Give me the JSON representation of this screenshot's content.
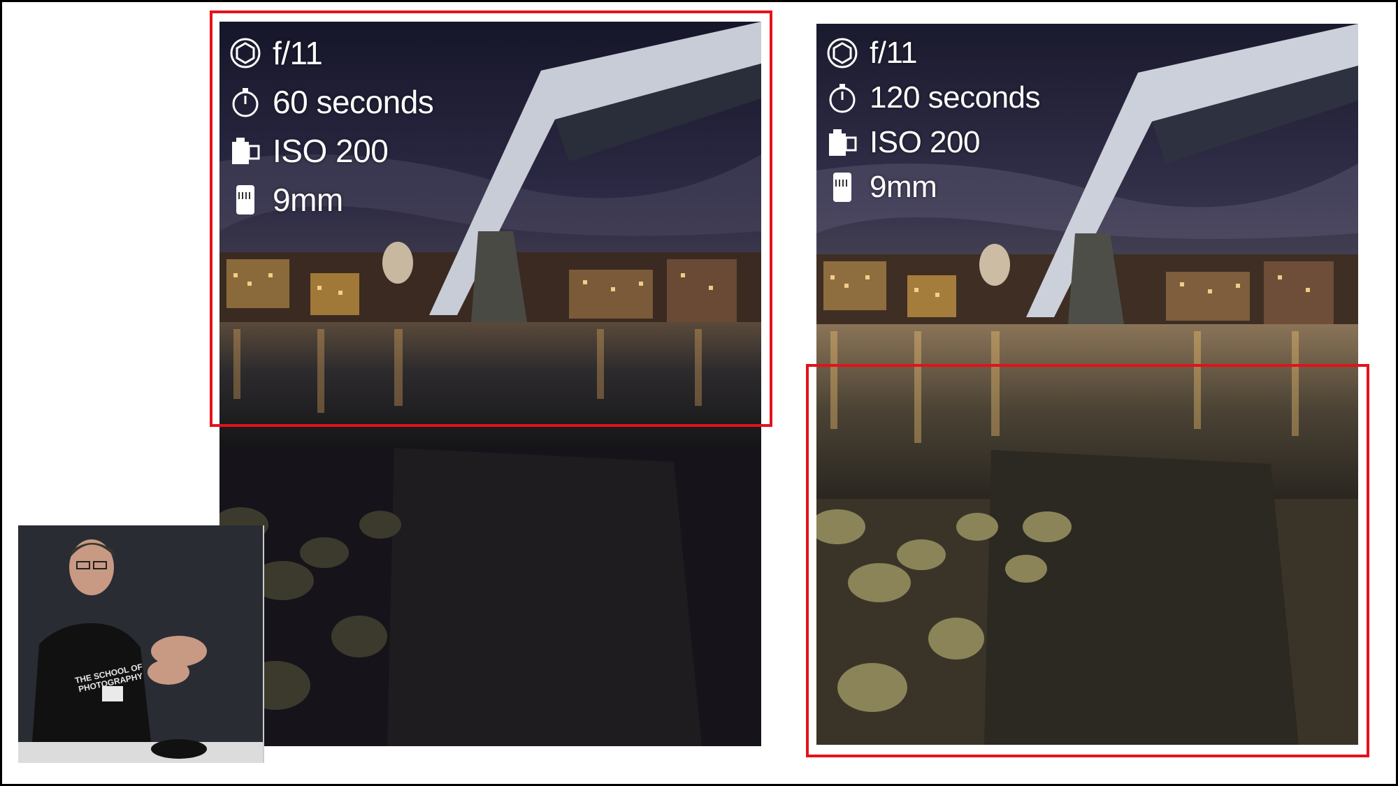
{
  "comparison": {
    "left": {
      "settings": [
        {
          "icon": "aperture-icon",
          "label": "f/11"
        },
        {
          "icon": "stopwatch-icon",
          "label": "60 seconds"
        },
        {
          "icon": "film-canister-icon",
          "label": "ISO 200"
        },
        {
          "icon": "lens-icon",
          "label": "9mm"
        }
      ]
    },
    "right": {
      "settings": [
        {
          "icon": "aperture-icon",
          "label": "f/11"
        },
        {
          "icon": "stopwatch-icon",
          "label": "120 seconds"
        },
        {
          "icon": "film-canister-icon",
          "label": "ISO 200"
        },
        {
          "icon": "lens-icon",
          "label": "9mm"
        }
      ]
    }
  },
  "presenter": {
    "shirt_text": "THE SCHOOL OF PHOTOGRAPHY"
  },
  "colors": {
    "highlight": "#e3121b",
    "background": "#ffffff",
    "text": "#ffffff"
  }
}
